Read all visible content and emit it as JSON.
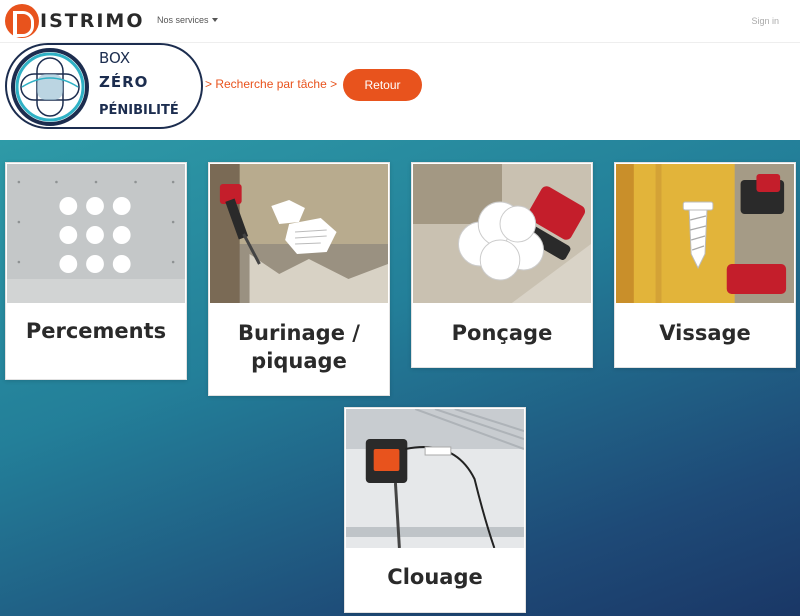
{
  "brand": {
    "logo_text": "ISTRIMO",
    "accent": "#e8531d"
  },
  "nav": {
    "services_label": "Nos services",
    "signin_label": "Sign in"
  },
  "box_logo": {
    "line1": "BOX",
    "line2": "ZÉRO",
    "line3": "PÉNIBILITÉ"
  },
  "breadcrumb": {
    "text": ">  Recherche par tâche >"
  },
  "back_button": {
    "label": "Retour"
  },
  "cards": [
    {
      "title": "Percements",
      "icon": "drill-holes"
    },
    {
      "title": "Burinage / piquage",
      "icon": "chisel"
    },
    {
      "title": "Ponçage",
      "icon": "sanding-discs"
    },
    {
      "title": "Vissage",
      "icon": "screw"
    },
    {
      "title": "Clouage",
      "icon": "nailer"
    }
  ]
}
